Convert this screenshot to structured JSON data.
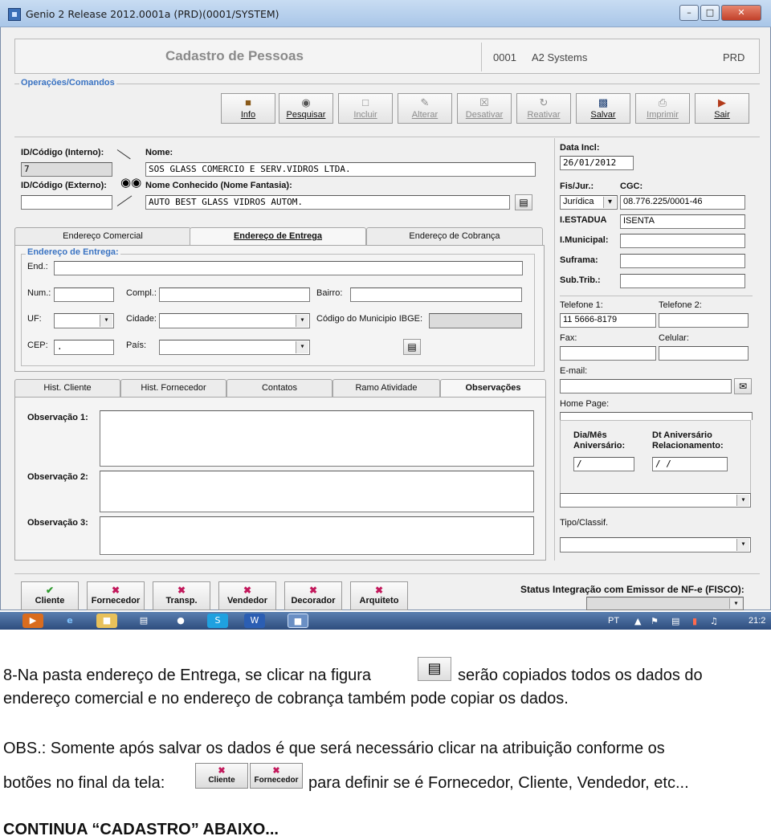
{
  "window": {
    "title": "Genio 2 Release 2012.0001a (PRD)(0001/SYSTEM)",
    "min_glyph": "–",
    "max_glyph": "□",
    "close_glyph": "✕"
  },
  "header": {
    "title": "Cadastro de Pessoas",
    "company_code": "0001",
    "company_name": "A2 Systems",
    "environment": "PRD"
  },
  "toolbar": {
    "group_label": "Operações/Comandos",
    "buttons": [
      {
        "label": "Info",
        "icon": "info-icon"
      },
      {
        "label": "Pesquisar",
        "icon": "binoculars-icon"
      },
      {
        "label": "Incluir",
        "icon": "new-doc-icon"
      },
      {
        "label": "Alterar",
        "icon": "edit-icon"
      },
      {
        "label": "Desativar",
        "icon": "deactivate-icon"
      },
      {
        "label": "Reativar",
        "icon": "reactivate-icon"
      },
      {
        "label": "Salvar",
        "icon": "save-icon"
      },
      {
        "label": "Imprimir",
        "icon": "print-icon"
      },
      {
        "label": "Sair",
        "icon": "exit-icon"
      }
    ]
  },
  "ident": {
    "id_interno_label": "ID/Código (Interno):",
    "id_interno_value": "7",
    "id_externo_label": "ID/Código (Externo):",
    "id_externo_value": "",
    "nome_label": "Nome:",
    "nome_value": "SOS GLASS COMERCIO E SERV.VIDROS LTDA.",
    "fantasia_label": "Nome Conhecido (Nome Fantasia):",
    "fantasia_value": "AUTO BEST GLASS VIDROS AUTOM."
  },
  "address_tabs": {
    "tabs": [
      "Endereço Comercial",
      "Endereço de Entrega",
      "Endereço de Cobrança"
    ],
    "group_label": "Endereço de Entrega:",
    "end_label": "End.:",
    "num_label": "Num.:",
    "compl_label": "Compl.:",
    "bairro_label": "Bairro:",
    "uf_label": "UF:",
    "cidade_label": "Cidade:",
    "ibge_label": "Código do Municipio IBGE:",
    "cep_label": "CEP:",
    "cep_value": ".",
    "pais_label": "País:"
  },
  "lower_tabs": {
    "tabs": [
      "Hist. Cliente",
      "Hist. Fornecedor",
      "Contatos",
      "Ramo Atividade",
      "Observações"
    ],
    "obs1_label": "Observação 1:",
    "obs2_label": "Observação 2:",
    "obs3_label": "Observação 3:"
  },
  "right_panel": {
    "data_incl_label": "Data Incl:",
    "data_incl_value": "26/01/2012",
    "fis_jur_label": "Fis/Jur.:",
    "fis_jur_value": "Jurídica",
    "cgc_label": "CGC:",
    "cgc_value": "08.776.225/0001-46",
    "ie_label": "I.ESTADUA",
    "ie_value": "ISENTA",
    "im_label": "I.Municipal:",
    "suframa_label": "Suframa:",
    "subtrib_label": "Sub.Trib.:",
    "tel1_label": "Telefone 1:",
    "tel1_value": "11 5666-8179",
    "tel2_label": "Telefone 2:",
    "fax_label": "Fax:",
    "celular_label": "Celular:",
    "email_label": "E-mail:",
    "homepage_label": "Home Page:",
    "aniv_label_1": "Dia/Mês",
    "aniv_label_2": "Aniversário:",
    "dt_rel_label_1": "Dt Aniversário",
    "dt_rel_label_2": "Relacionamento:",
    "aniv_value": "/",
    "dt_rel_value": "/ /",
    "tipo_label": "Tipo/Classif."
  },
  "bottom_buttons": [
    {
      "label": "Cliente",
      "icon": "check-icon",
      "color": "#2e9a2e"
    },
    {
      "label": "Fornecedor",
      "icon": "x-icon",
      "color": "#c2185b"
    },
    {
      "label": "Transp.",
      "icon": "x-icon",
      "color": "#c2185b"
    },
    {
      "label": "Vendedor",
      "icon": "x-icon",
      "color": "#c2185b"
    },
    {
      "label": "Decorador",
      "icon": "x-icon",
      "color": "#c2185b"
    },
    {
      "label": "Arquiteto",
      "icon": "x-icon",
      "color": "#c2185b"
    }
  ],
  "status_integration": {
    "label": "Status Integração com Emissor de NF-e (FISCO):"
  },
  "taskbar": {
    "language": "PT",
    "clock": "21:2"
  },
  "document": {
    "line1_a": "8-Na pasta endereço de Entrega, se clicar na figura",
    "line1_b": "serão copiados todos os dados do",
    "line2": "endereço comercial e no endereço de cobrança também pode copiar os dados.",
    "line3": "OBS.: Somente após salvar os dados é que será necessário clicar na atribuição conforme os",
    "line4_a": "botões no final da tela:",
    "line4_b": "para definir se é Fornecedor, Cliente, Vendedor, etc...",
    "sample_cliente": "Cliente",
    "sample_fornecedor": "Fornecedor",
    "footer": "CONTINUA “CADASTRO” ABAIXO..."
  },
  "colors": {
    "group_label": "#3a73c2",
    "check": "#2e9a2e",
    "x": "#c2185b",
    "taskbar": "#2e4d7e"
  }
}
